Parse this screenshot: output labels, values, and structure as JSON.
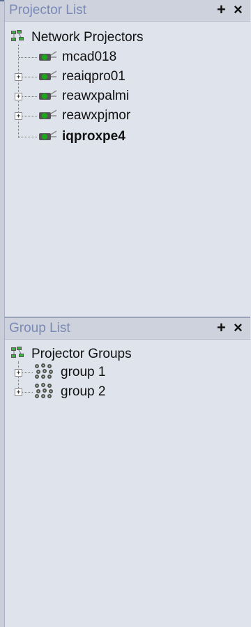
{
  "projector_list": {
    "title": "Projector List",
    "add_icon": "+",
    "close_icon": "×",
    "root": {
      "label": "Network Projectors",
      "icon": "network-icon"
    },
    "items": [
      {
        "label": "mcad018",
        "expandable": false,
        "bold": false,
        "icon": "projector-icon"
      },
      {
        "label": "reaiqpro01",
        "expandable": true,
        "bold": false,
        "icon": "projector-icon"
      },
      {
        "label": "reawxpalmi",
        "expandable": true,
        "bold": false,
        "icon": "projector-icon"
      },
      {
        "label": "reawxpjmor",
        "expandable": true,
        "bold": false,
        "icon": "projector-icon"
      },
      {
        "label": "iqproxpe4",
        "expandable": false,
        "bold": true,
        "icon": "projector-icon"
      }
    ]
  },
  "group_list": {
    "title": "Group List",
    "add_icon": "+",
    "close_icon": "×",
    "root": {
      "label": "Projector Groups",
      "icon": "network-icon"
    },
    "items": [
      {
        "label": "group 1",
        "expandable": true,
        "icon": "group-icon"
      },
      {
        "label": "group 2",
        "expandable": true,
        "icon": "group-icon"
      }
    ]
  },
  "colors": {
    "panel_bg": "#dfe3ec",
    "title_text": "#7b89b6",
    "projector_lens": "#18a818"
  }
}
